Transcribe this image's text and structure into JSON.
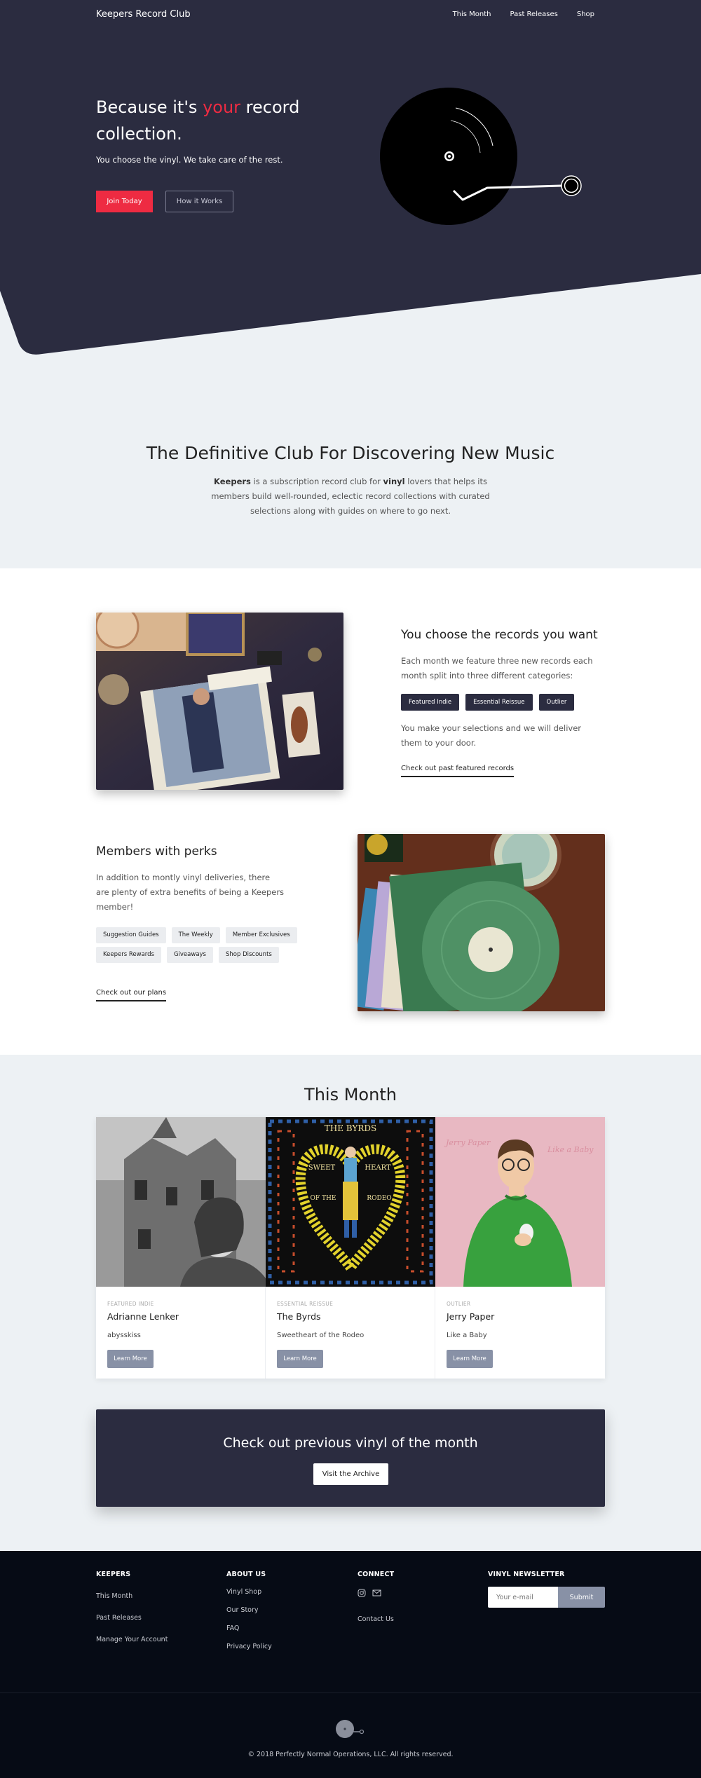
{
  "nav": {
    "brand": "Keepers Record Club",
    "links": [
      "This Month",
      "Past Releases",
      "Shop"
    ]
  },
  "hero": {
    "title_pre": "Because it's ",
    "title_accent": "your",
    "title_post": " record collection.",
    "subtitle": "You choose the vinyl. We take care of the rest.",
    "join_label": "Join Today",
    "how_label": "How it Works"
  },
  "intro": {
    "title": "The Definitive Club For Discovering New Music",
    "body_b1": "Keepers",
    "body_t1": " is a subscription record club for ",
    "body_b2": "vinyl",
    "body_t2": " lovers that helps its members build well-rounded, eclectic record collections with curated selections along with guides on where to go next."
  },
  "feature1": {
    "title": "You choose the records you want",
    "body": "Each month we feature three new records each month split into three different categories:",
    "tags": [
      "Featured Indie",
      "Essential Reissue",
      "Outlier"
    ],
    "body2": "You make your selections and we will deliver them to your door.",
    "link": "Check out past featured records"
  },
  "feature2": {
    "title": "Members with perks",
    "body": "In addition to montly vinyl deliveries, there are plenty of extra benefits of being a Keepers member!",
    "tags": [
      "Suggestion Guides",
      "The Weekly",
      "Member Exclusives",
      "Keepers Rewards",
      "Giveaways",
      "Shop Discounts"
    ],
    "link": "Check out our plans"
  },
  "this_month": {
    "title": "This Month",
    "cards": [
      {
        "category": "FEATURED INDIE",
        "artist": "Adrianne Lenker",
        "album": "abysskiss",
        "button": "Learn More"
      },
      {
        "category": "ESSENTIAL REISSUE",
        "artist": "The Byrds",
        "album": "Sweetheart of the Rodeo",
        "button": "Learn More",
        "cover_text_top": "THE BYRDS",
        "cover_text_left": "SWEET",
        "cover_text_right": "HEART",
        "cover_text_mid_left": "OF THE",
        "cover_text_mid_right": "RODEO"
      },
      {
        "category": "OUTLIER",
        "artist": "Jerry Paper",
        "album": "Like a Baby",
        "button": "Learn More",
        "cover_text_left": "Jerry Paper",
        "cover_text_right": "Like a Baby"
      }
    ]
  },
  "archive": {
    "title": "Check out previous vinyl of the month",
    "button": "Visit the Archive"
  },
  "footer": {
    "col1": {
      "title": "KEEPERS",
      "links": [
        "This Month",
        "Past Releases",
        "Manage Your Account"
      ]
    },
    "col2": {
      "title": "ABOUT US",
      "links": [
        "Vinyl Shop",
        "Our Story",
        "FAQ",
        "Privacy Policy"
      ]
    },
    "col3": {
      "title": "CONNECT",
      "social": [
        "instagram-icon",
        "mail-icon"
      ],
      "links": [
        "Contact Us"
      ]
    },
    "col4": {
      "title": "VINYL NEWSLETTER",
      "placeholder": "Your e-mail",
      "submit": "Submit"
    },
    "copyright": "© 2018 Perfectly Normal Operations, LLC. All rights reserved."
  },
  "colors": {
    "navy": "#2b2c40",
    "accent": "#ee2b42",
    "light_bg": "#edf1f4",
    "footer_bg": "#060b15",
    "button_gray": "#8891a6"
  }
}
